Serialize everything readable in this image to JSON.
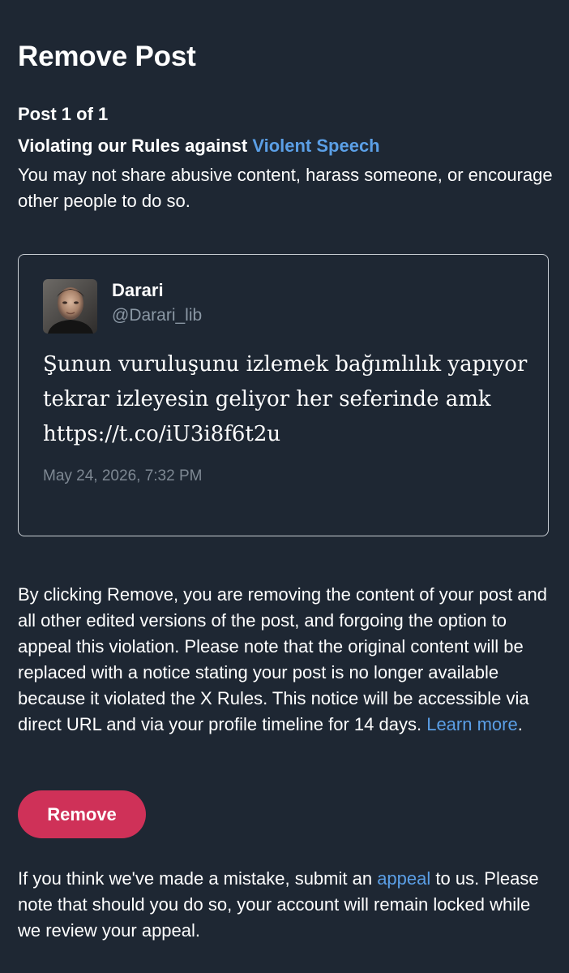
{
  "header": {
    "title": "Remove Post",
    "post_counter": "Post 1 of 1"
  },
  "violation": {
    "heading_prefix": "Violating our Rules against ",
    "rule_name": "Violent Speech",
    "description": "You may not share abusive content, harass someone, or encourage other people to do so."
  },
  "post": {
    "author_name": "Darari",
    "author_handle": "@Darari_lib",
    "text": "Şunun vuruluşunu izlemek bağımlılık yapıyor tekrar izleyesin geliyor her seferinde amk https://t.co/iU3i8f6t2u",
    "timestamp": "May 24, 2026, 7:32 PM"
  },
  "notice": {
    "text": "By clicking Remove, you are removing the content of your post and all other edited versions of the post, and forgoing the option to appeal this violation. Please note that the original content will be replaced with a notice stating your post is no longer available because it violated the X Rules. This notice will be accessible via direct URL and via your profile timeline for 14 days. ",
    "learn_more": "Learn more",
    "end": "."
  },
  "actions": {
    "remove_label": "Remove"
  },
  "footer": {
    "text_before": "If you think we've made a mistake, submit an ",
    "appeal_link": "appeal",
    "text_after": " to us. Please note that should you do so, your account will remain locked while we review your appeal."
  },
  "colors": {
    "background": "#1e2733",
    "link": "#5b9fe6",
    "remove_button": "#cf3158",
    "muted_text": "#8b98a5"
  }
}
